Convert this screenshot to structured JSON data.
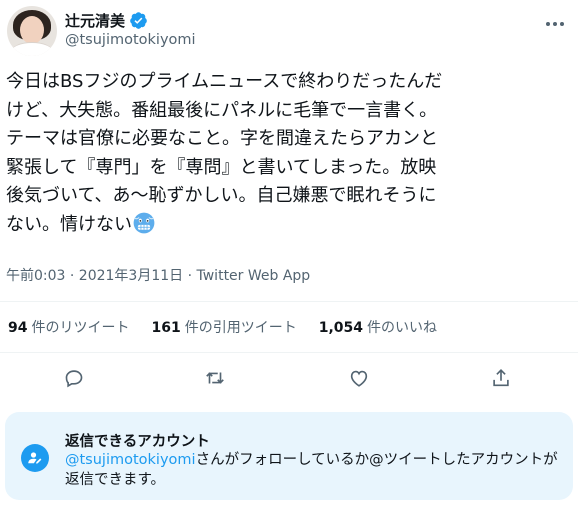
{
  "user": {
    "display_name": "辻元清美",
    "handle": "@tsujimotokiyomi"
  },
  "tweet": {
    "lines": [
      "今日はBSフジのプライムニュースで終わりだったんだ",
      "けど、大失態。番組最後にパネルに毛筆で一言書く。",
      "テーマは官僚に必要なこと。字を間違えたらアカンと",
      "緊張して『専門」を『専問』と書いてしまった。放映",
      "後気づいて、あ〜恥ずかしい。自己嫌悪で眠れそうに"
    ],
    "last_line": "ない。情けない",
    "emoji": "cold-face-emoji"
  },
  "meta": {
    "time": "午前0:03 · 2021年3月11日 · ",
    "source": "Twitter Web App"
  },
  "stats": {
    "retweets_count": "94",
    "retweets_label": "件のリツイート",
    "quotes_count": "161",
    "quotes_label": "件の引用ツイート",
    "likes_count": "1,054",
    "likes_label": "件のいいね"
  },
  "actions": [
    "reply-icon",
    "retweet-icon",
    "like-icon",
    "share-icon"
  ],
  "reply_settings": {
    "title": "返信できるアカウント",
    "mention": "@tsujimotokiyomi",
    "desc_rest": "さんがフォローしているか@ツイートしたアカウントが返信できます。"
  },
  "colors": {
    "accent": "#1d9bf0",
    "text": "#0f1419",
    "secondary": "#536471",
    "reply_bg": "#e8f5fd"
  }
}
